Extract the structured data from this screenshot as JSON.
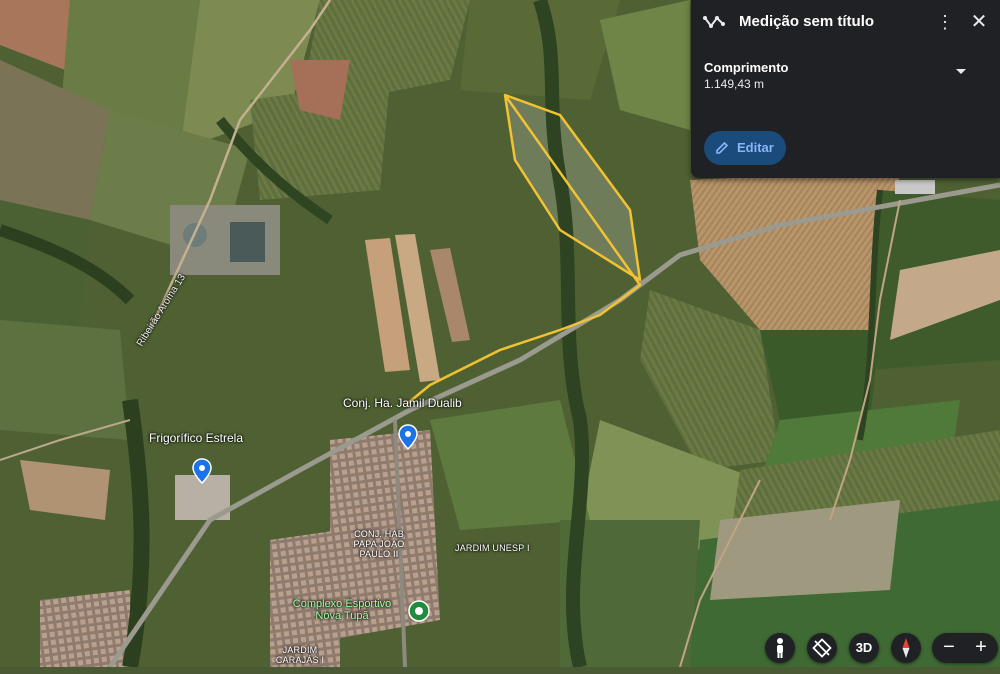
{
  "panel": {
    "title": "Medição sem título",
    "measure_label": "Comprimento",
    "measure_value": "1.149,43 m",
    "edit_label": "Editar",
    "icons": {
      "measure": "ruler-path-icon",
      "more": "more-vert-icon",
      "close": "close-icon",
      "dropdown": "caret-down-icon",
      "edit": "pencil-icon"
    }
  },
  "map_labels": {
    "road": "Ribeirão Aroma 13",
    "conj_jamil": "Conj. Ha. Jamil Dualib",
    "frigorifico": "Frigorífico Estrela",
    "conj_papa_line1": "CONJ. HAB",
    "conj_papa_line2": "PAPA JOAO",
    "conj_papa_line3": "PAULO II",
    "jardim_unesp": "JARDIM UNESP I",
    "complexo_line1": "Complexo Esportivo",
    "complexo_line2": "Nova Tupã",
    "jardim_carajas_line1": "JARDIM",
    "jardim_carajas_line2": "CARAJÁS I"
  },
  "controls": {
    "street_view_icon": "pegman-icon",
    "tilt_icon": "rotate-tilt-icon",
    "mode_3d": "3D",
    "compass_icon": "compass-icon",
    "zoom_out": "−",
    "zoom_in": "+"
  },
  "colors": {
    "measure_line": "#f3c233",
    "panel_bg": "#202124",
    "edit_btn_bg": "#1a4b7a",
    "edit_btn_text": "#8ab4f8",
    "pin_blue": "#1a73e8",
    "pin_green": "#1e8e3e"
  }
}
